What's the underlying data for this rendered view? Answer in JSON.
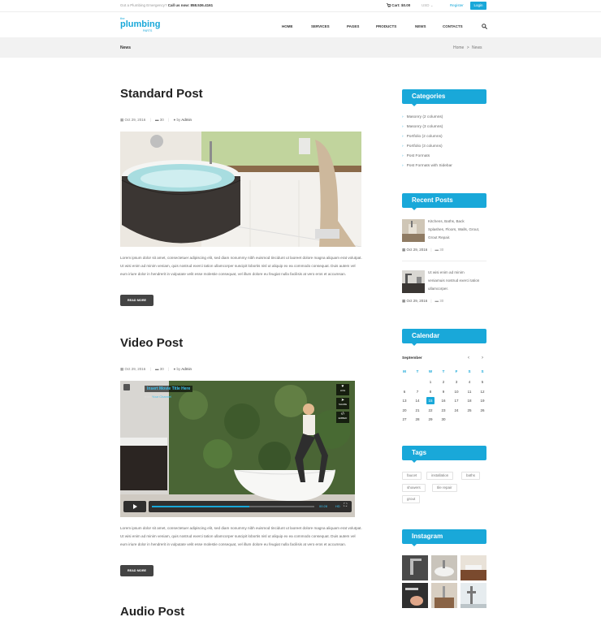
{
  "topbar": {
    "emergency_label": "Got a Plumbing Emergency?",
    "emergency_phone": "Call us now: 858.536.4161",
    "cart": "Cart: $0.00",
    "currency": "USD",
    "register": "Register",
    "login": "Login"
  },
  "logo": {
    "the": "the",
    "main": "plumbing",
    "parts": "PARTS"
  },
  "nav": [
    "HOME",
    "SERVICES",
    "PAGES",
    "PRODUCTS",
    "NEWS",
    "CONTACTS"
  ],
  "breadcrumb": {
    "title": "News",
    "home": "Home",
    "sep": ">",
    "current": "News"
  },
  "posts": [
    {
      "title": "Standard Post",
      "date": "Oct 29, 2016",
      "comments": "30",
      "by": "by",
      "author": "Admin",
      "excerpt": "Lorem ipsum dolor sit amet, consectetuer adipiscing elit, sed diam nonummy nibh euismod tincidunt ut laoreet dolore magna aliquam erat volutpat. Ut wisi enim ad minim veniam, quis nostrud exerci tation ullamcorper suscipit lobortis nisl ut aliquip ex ea commodo consequat. Duis autem vel eum iriure dolor in hendrerit in vulputate velit esse molestie consequat, vel illum dolore eu feugiat nulla facilisis at vero eros et accumsan.",
      "read_more": "READ MORE"
    },
    {
      "title": "Video Post",
      "date": "Oct 29, 2016",
      "comments": "30",
      "by": "by",
      "author": "Admin",
      "excerpt": "Lorem ipsum dolor sit amet, consectetuer adipiscing elit, sed diam nonummy nibh euismod tincidunt ut laoreet dolore magna aliquam erat volutpat. Ut wisi enim ad minim veniam, quis nostrud exerci tation ullamcorper suscipit lobortis nisl ut aliquip ex ea commodo consequat. Duis autem vel eum iriure dolor in hendrerit in vulputate velit esse molestie consequat, vel illum dolore eu feugiat nulla facilisis at vero eros et accumsan.",
      "read_more": "READ MORE"
    },
    {
      "title": "Audio Post"
    }
  ],
  "video": {
    "title": "Insert Movie Title Here",
    "from": "from",
    "user": "Your Channel",
    "like": "LIKE",
    "share": "SHARE",
    "embed": "EMBED",
    "time": "00:28",
    "hd": "HD",
    "progress": 0.6
  },
  "sidebar": {
    "categories_title": "Categories",
    "categories": [
      "Masonry (2 columns)",
      "Masonry (3 columns)",
      "Portfolio (2 columns)",
      "Portfolio (3 columns)",
      "Post Formats",
      "Post Formats with Sidebar"
    ],
    "recent_title": "Recent Posts",
    "recent": [
      {
        "text": "Kitchens, Baths, Back Splashes, Floors, Walls, Grout, Grout Repair.",
        "date": "Oct 29, 2016",
        "comments": "30"
      },
      {
        "text": "Ut wisi enim ad minim veniamuis nostrud exerci tation ullamcorper.",
        "date": "Oct 29, 2016",
        "comments": "30"
      }
    ],
    "calendar_title": "Calendar",
    "calendar_month": "September",
    "calendar_prev": "‹",
    "calendar_next": "›",
    "calendar_dow": [
      "M",
      "T",
      "W",
      "T",
      "F",
      "S",
      "S"
    ],
    "calendar_today": 15,
    "tags_title": "Tags",
    "tags": [
      "faucet",
      "installation",
      "baths",
      "showers",
      "tile repair",
      "grout"
    ],
    "instagram_title": "Instagram"
  },
  "colors": {
    "accent": "#19a8d9",
    "dark_button": "#444444",
    "band": "#f2f2f2"
  }
}
